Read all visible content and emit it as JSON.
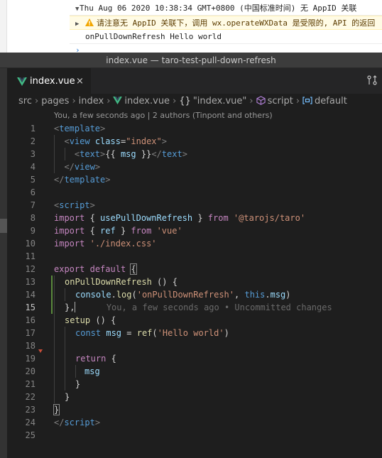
{
  "console": {
    "log_timestamp": "Thu Aug 06 2020 10:38:34 GMT+0800 (中国标准时间) 无 AppID 关联",
    "warning_text": "请注意无 AppID 关联下，调用 wx.operateWXData 是受限的, API 的返回",
    "log_output": "onPullDownRefresh Hello world",
    "prompt": "›"
  },
  "window": {
    "title": "index.vue — taro-test-pull-down-refresh"
  },
  "tab": {
    "label": "index.vue",
    "close": "×"
  },
  "breadcrumb": {
    "src": "src",
    "pages": "pages",
    "index": "index",
    "file": "index.vue",
    "braces": "{}",
    "block": "\"index.vue\"",
    "script": "script",
    "default": "default"
  },
  "codelens": "You, a few seconds ago | 2 authors (Tinpont and others)",
  "blame": "You, a few seconds ago • Uncommitted changes",
  "line_numbers": [
    "1",
    "2",
    "3",
    "4",
    "5",
    "6",
    "7",
    "8",
    "9",
    "10",
    "11",
    "12",
    "13",
    "14",
    "15",
    "16",
    "17",
    "18",
    "19",
    "20",
    "21",
    "22",
    "23",
    "24",
    "25"
  ],
  "code": {
    "l1": [
      "<",
      "template",
      ">"
    ],
    "l2": [
      "  <",
      "view",
      " ",
      "class",
      "=",
      "\"index\"",
      ">"
    ],
    "l3": [
      "    <",
      "text",
      ">",
      "{{ ",
      "msg",
      " }}",
      "</",
      "text",
      ">"
    ],
    "l4": [
      "  </",
      "view",
      ">"
    ],
    "l5": [
      "</",
      "template",
      ">"
    ],
    "l7": [
      "<",
      "script",
      ">"
    ],
    "l8": [
      "import",
      " { ",
      "usePullDownRefresh",
      " } ",
      "from",
      " ",
      "'@tarojs/taro'"
    ],
    "l9": [
      "import",
      " { ",
      "ref",
      " } ",
      "from",
      " ",
      "'vue'"
    ],
    "l10": [
      "import",
      " ",
      "'./index.css'"
    ],
    "l12": [
      "export",
      " ",
      "default",
      " ",
      "{"
    ],
    "l13": [
      "onPullDownRefresh",
      " () {"
    ],
    "l14": [
      "console",
      ".",
      "log",
      "(",
      "'onPullDownRefresh'",
      ", ",
      "this",
      ".",
      "msg",
      ")"
    ],
    "l15": [
      "},"
    ],
    "l16": [
      "setup",
      " () {"
    ],
    "l17": [
      "const",
      " ",
      "msg",
      " = ",
      "ref",
      "(",
      "'Hello world'",
      ")"
    ],
    "l19": [
      "return",
      " {"
    ],
    "l20": [
      "msg"
    ],
    "l21": [
      "}"
    ],
    "l22": [
      "}"
    ],
    "l23": [
      "}"
    ],
    "l24": [
      "</",
      "script",
      ">"
    ]
  },
  "colors": {
    "editor_bg": "#1e1e1e",
    "keyword": "#569cd6",
    "string": "#ce9178",
    "function": "#dcdcaa",
    "variable": "#9cdcfe",
    "import": "#c586c0",
    "modified_gutter": "#5a8a3c",
    "vue_green": "#41b883"
  }
}
